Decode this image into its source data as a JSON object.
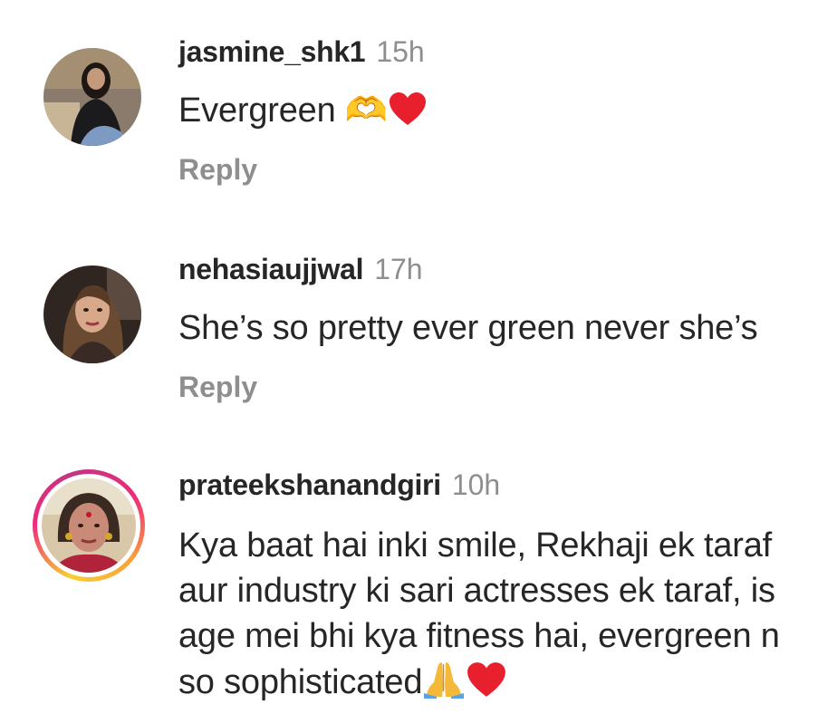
{
  "comments": [
    {
      "username": "jasmine_shk1",
      "time": "15h",
      "text": "Evergreen 🫶",
      "emojis": [
        "heart"
      ],
      "reply_label": "Reply",
      "avatar_icon": "profile-photo",
      "has_story_ring": false
    },
    {
      "username": "nehasiaujjwal",
      "time": "17h",
      "text": "She’s so pretty ever green never she’s",
      "emojis": [],
      "reply_label": "Reply",
      "avatar_icon": "profile-photo",
      "has_story_ring": false
    },
    {
      "username": "prateekshanandgiri",
      "time": "10h",
      "text": "Kya baat hai inki smile, Rekhaji ek taraf aur industry ki sari actresses ek taraf, is age mei bhi kya fitness hai, evergreen n so sophisticated",
      "emojis": [
        "folded-hands",
        "heart"
      ],
      "reply_label": "",
      "avatar_icon": "profile-photo",
      "has_story_ring": true
    }
  ],
  "colors": {
    "username": "#262626",
    "secondary": "#8e8e8e",
    "heart": "#e8202e",
    "story_ring_start": "#f9ce34",
    "story_ring_end": "#ee2a7b"
  }
}
